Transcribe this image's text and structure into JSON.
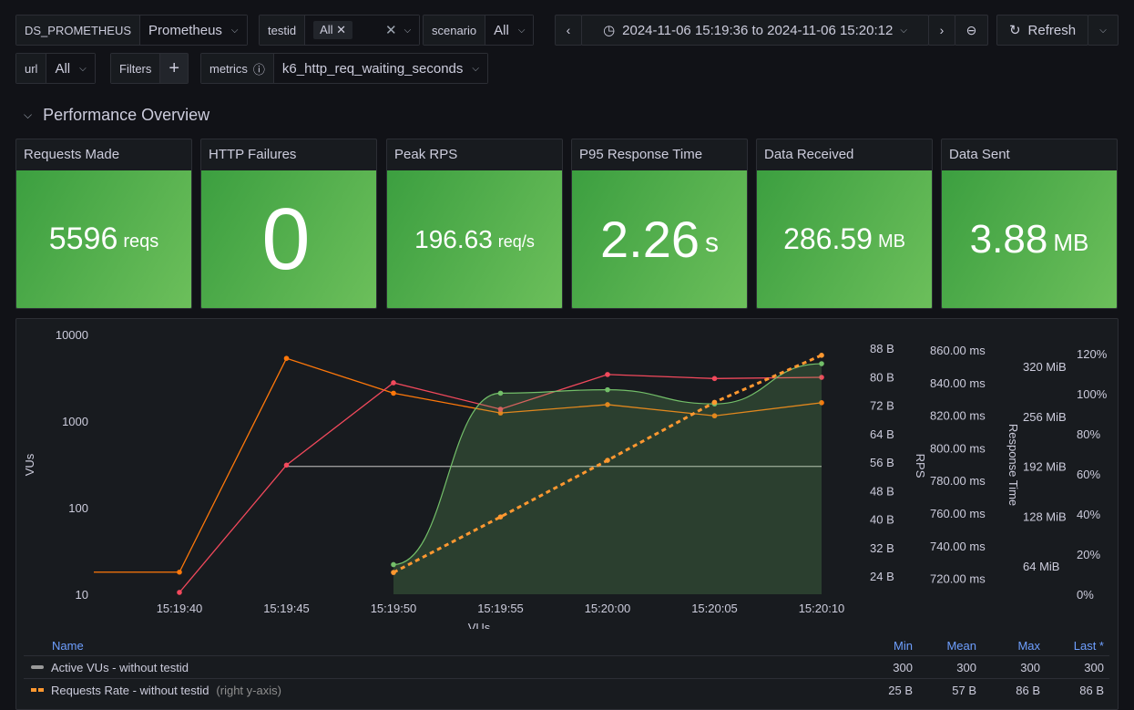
{
  "vars": {
    "ds": {
      "label": "DS_PROMETHEUS",
      "value": "Prometheus"
    },
    "testid": {
      "label": "testid",
      "chip": "All"
    },
    "scenario": {
      "label": "scenario",
      "value": "All"
    },
    "url": {
      "label": "url",
      "value": "All"
    },
    "filters": {
      "label": "Filters"
    },
    "metrics": {
      "label": "metrics",
      "value": "k6_http_req_waiting_seconds"
    }
  },
  "time": {
    "range": "2024-11-06 15:19:36 to 2024-11-06 15:20:12",
    "refresh": "Refresh"
  },
  "section": {
    "title": "Performance Overview"
  },
  "stats": [
    {
      "title": "Requests Made",
      "value": "5596",
      "unit": "reqs"
    },
    {
      "title": "HTTP Failures",
      "value": "0",
      "unit": ""
    },
    {
      "title": "Peak RPS",
      "value": "196.63",
      "unit": "req/s"
    },
    {
      "title": "P95 Response Time",
      "value": "2.26",
      "unit": "s"
    },
    {
      "title": "Data Received",
      "value": "286.59",
      "unit": "MB"
    },
    {
      "title": "Data Sent",
      "value": "3.88",
      "unit": "MB"
    }
  ],
  "stat_color": "#56a64b",
  "chart_data": {
    "type": "line",
    "xlabel": "VUs",
    "ylabel": "VUs",
    "yscale": "log",
    "ylim": [
      10,
      10000
    ],
    "x_ticks": [
      "15:19:40",
      "15:19:45",
      "15:19:50",
      "15:19:55",
      "15:20:00",
      "15:20:05",
      "15:20:10"
    ],
    "y_ticks": [
      "10",
      "100",
      "1000",
      "10000"
    ],
    "right_axes": [
      {
        "label": "RPS",
        "ticks": [
          "88 B",
          "80 B",
          "72 B",
          "64 B",
          "56 B",
          "48 B",
          "40 B",
          "32 B",
          "24 B"
        ],
        "ylim": [
          24,
          88
        ]
      },
      {
        "label": "",
        "ticks": [
          "860.00 ms",
          "840.00 ms",
          "820.00 ms",
          "800.00 ms",
          "780.00 ms",
          "760.00 ms",
          "740.00 ms",
          "720.00 ms"
        ]
      },
      {
        "label": "Response Time",
        "ticks": [
          "320 MiB",
          "256 MiB",
          "192 MiB",
          "128 MiB",
          "64 MiB"
        ]
      },
      {
        "label": "",
        "ticks": [
          "120%",
          "100%",
          "80%",
          "60%",
          "40%",
          "20%",
          "0%"
        ]
      }
    ],
    "series": [
      {
        "name": "Active VUs - without testid",
        "color": "#9a9a9a",
        "axis": "left",
        "x": [
          "15:19:45",
          "15:20:10"
        ],
        "y": [
          300,
          300
        ]
      },
      {
        "color": "#ff780a",
        "axis": "left",
        "x": [
          "15:19:36",
          "15:19:40",
          "15:19:45",
          "15:19:50",
          "15:19:55",
          "15:20:00",
          "15:20:05",
          "15:20:10"
        ],
        "y": [
          18,
          18,
          5300,
          2100,
          1240,
          1550,
          1150,
          1630
        ]
      },
      {
        "color": "#f2495c",
        "axis": "left",
        "x": [
          "15:19:40",
          "15:19:45",
          "15:19:50",
          "15:19:55",
          "15:20:00",
          "15:20:05",
          "15:20:10"
        ],
        "y": [
          10.5,
          310,
          2770,
          1370,
          3450,
          3100,
          3200
        ]
      },
      {
        "color": "#73bf69",
        "axis": "left",
        "fill": true,
        "x": [
          "15:19:50",
          "15:19:55",
          "15:20:00",
          "15:20:05",
          "15:20:10"
        ],
        "y": [
          22,
          2100,
          2300,
          1580,
          4600
        ]
      },
      {
        "name": "Requests Rate - without testid",
        "color": "#ff9830",
        "axis": "right",
        "dashed": true,
        "x": [
          "15:19:50",
          "15:19:55",
          "15:20:00",
          "15:20:05",
          "15:20:10"
        ],
        "y": [
          25,
          40.6,
          56.5,
          72.8,
          86
        ]
      }
    ]
  },
  "legend": {
    "headers": [
      "Name",
      "Min",
      "Mean",
      "Max",
      "Last *"
    ],
    "rows": [
      {
        "name": "Active VUs - without testid",
        "suffix": "",
        "min": "300",
        "mean": "300",
        "max": "300",
        "last": "300"
      },
      {
        "name": "Requests Rate - without testid",
        "suffix": "(right y-axis)",
        "min": "25 B",
        "mean": "57 B",
        "max": "86 B",
        "last": "86 B"
      }
    ]
  }
}
